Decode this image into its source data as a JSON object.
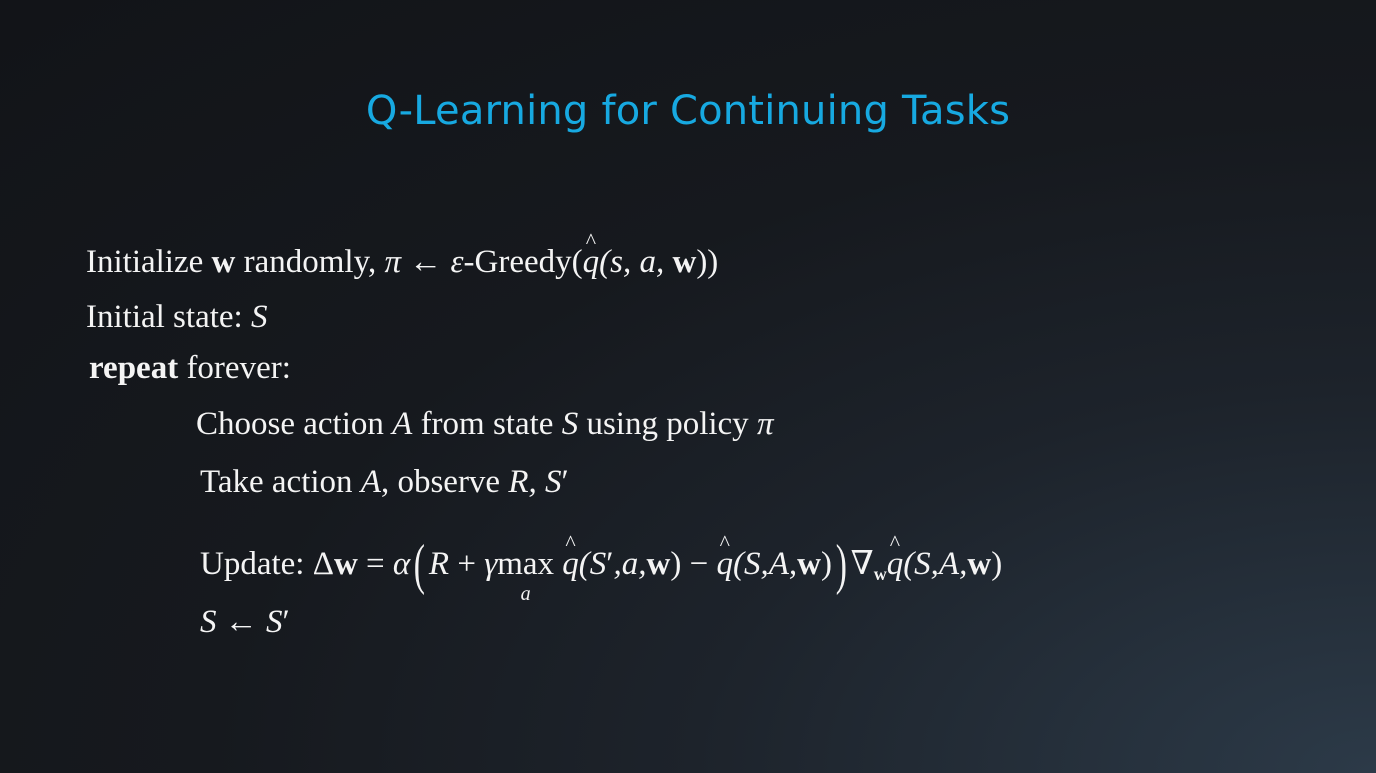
{
  "slide": {
    "title": "Q-Learning for Continuing Tasks"
  },
  "algorithm": {
    "init_line": {
      "t1": "Initialize ",
      "w": "w",
      "t2": " randomly, ",
      "pi": "π",
      "arrow": " ← ",
      "eps": "ε",
      "t3": "-Greedy(",
      "q": "q",
      "args": "(s, a, ",
      "w2": "w",
      "close": "))"
    },
    "state_line": {
      "t1": "Initial state: ",
      "S": "S"
    },
    "repeat_line": {
      "kw": "repeat",
      "t1": " forever:"
    },
    "choose_line": {
      "t1": "Choose action ",
      "A": "A",
      "t2": " from state ",
      "S": "S",
      "t3": " using policy ",
      "pi": "π"
    },
    "take_line": {
      "t1": "Take action ",
      "A": "A",
      "t2": ", observe ",
      "R": "R, S",
      "prime": "′"
    },
    "update_line": {
      "label": "Update: ",
      "delta": "Δ",
      "w": "w",
      "eq": " = ",
      "alpha": "α",
      "lparen": "(",
      "R": "R",
      "plus": " + ",
      "gamma": "γ",
      "max": " max",
      "max_sub": "a",
      "q1": "q",
      "args1a": "(S",
      "prime1": "′",
      "args1b": ",a,",
      "w1": "w",
      "close1": ")",
      "minus": " − ",
      "q2": "q",
      "args2": "(S,A,",
      "w2": "w",
      "close2": ")",
      "rparen": ")",
      "nabla": "∇",
      "nabla_sub": "w",
      "q3": "q",
      "args3": "(S,A,",
      "w3": "w",
      "close3": ")"
    },
    "assign_line": {
      "S": "S",
      "arrow": " ← ",
      "S2": "S",
      "prime": "′"
    }
  }
}
